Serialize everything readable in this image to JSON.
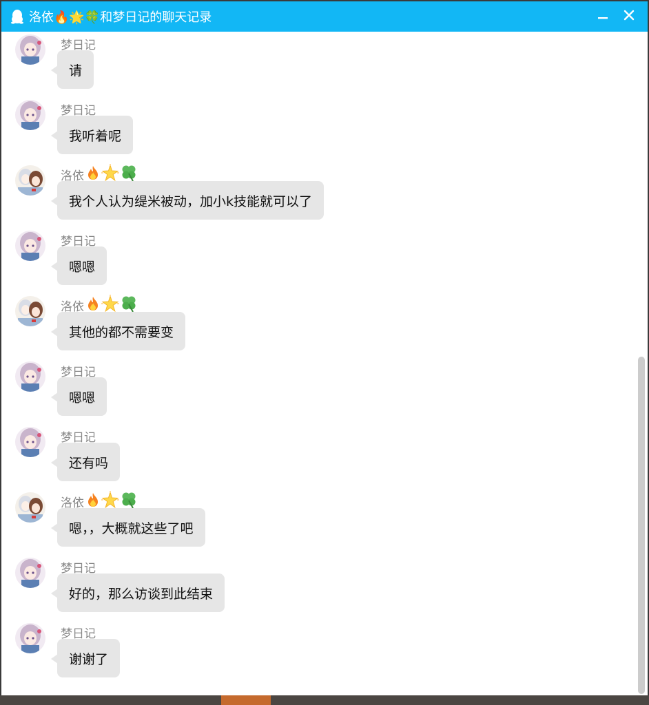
{
  "window": {
    "title": "洛依🔥🌟🍀和梦日记的聊天记录"
  },
  "colors": {
    "titlebar": "#12b7f5",
    "bubble": "#e6e6e6",
    "sender_text": "#8a8a8a"
  },
  "icons": {
    "title": "qq-penguin-icon",
    "minimize": "minimize-icon",
    "close": "close-icon"
  },
  "senders": {
    "dream": "梦日记",
    "luoyi": "洛依"
  },
  "messages": [
    {
      "sender": "梦日记",
      "text": "请"
    },
    {
      "sender": "梦日记",
      "text": "我听着呢"
    },
    {
      "sender": "洛依",
      "text": "我个人认为缇米被动，加小k技能就可以了"
    },
    {
      "sender": "梦日记",
      "text": "嗯嗯"
    },
    {
      "sender": "洛依",
      "text": "其他的都不需要变"
    },
    {
      "sender": "梦日记",
      "text": "嗯嗯"
    },
    {
      "sender": "梦日记",
      "text": "还有吗"
    },
    {
      "sender": "洛依",
      "text": "嗯，，大概就这些了吧"
    },
    {
      "sender": "梦日记",
      "text": "好的，那么访谈到此结束"
    },
    {
      "sender": "梦日记",
      "text": "谢谢了"
    }
  ]
}
